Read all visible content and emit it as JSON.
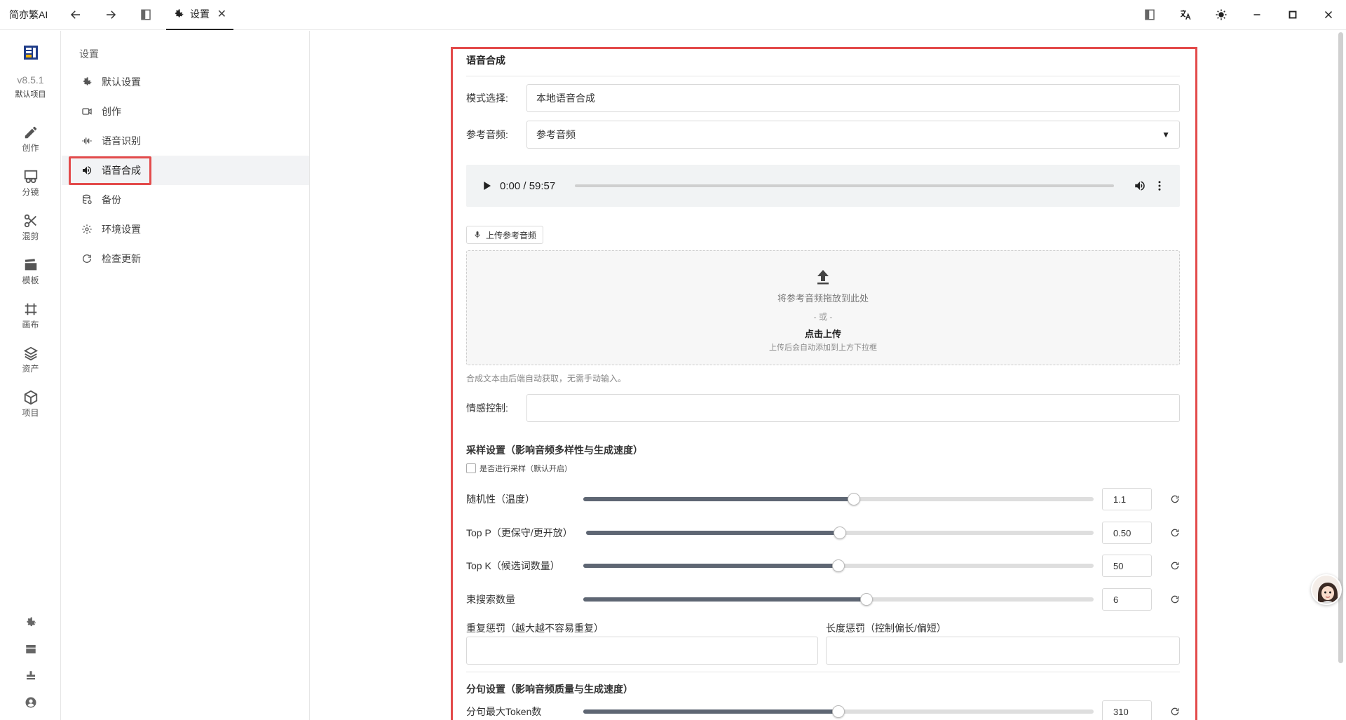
{
  "app": {
    "name": "简亦繁AI"
  },
  "tab": {
    "label": "设置",
    "close": "✕"
  },
  "rail": {
    "version": "v8.5.1",
    "project": "默认项目",
    "items": [
      {
        "label": "创作",
        "icon": "pencil-icon"
      },
      {
        "label": "分镜",
        "icon": "storyboard-icon"
      },
      {
        "label": "混剪",
        "icon": "scissors-icon"
      },
      {
        "label": "模板",
        "icon": "clapperboard-icon"
      },
      {
        "label": "画布",
        "icon": "canvas-icon"
      },
      {
        "label": "资产",
        "icon": "layers-icon"
      },
      {
        "label": "项目",
        "icon": "cube-icon"
      }
    ]
  },
  "settings_nav": {
    "title": "设置",
    "items": [
      {
        "label": "默认设置",
        "icon": "gear-icon"
      },
      {
        "label": "创作",
        "icon": "video-icon"
      },
      {
        "label": "语音识别",
        "icon": "waveform-icon"
      },
      {
        "label": "语音合成",
        "icon": "speaker-icon"
      },
      {
        "label": "备份",
        "icon": "database-icon"
      },
      {
        "label": "环境设置",
        "icon": "cog-icon"
      },
      {
        "label": "检查更新",
        "icon": "refresh-icon"
      }
    ],
    "active_index": 3
  },
  "panel": {
    "title": "语音合成",
    "mode_label": "模式选择:",
    "mode_value": "本地语音合成",
    "ref_audio_label": "参考音频:",
    "ref_audio_value": "参考音频",
    "audio_time": "0:00 / 59:57",
    "upload_button": "上传参考音频",
    "dropzone": {
      "text": "将参考音频拖放到此处",
      "or": "- 或 -",
      "click": "点击上传",
      "hint": "上传后会自动添加到上方下拉框"
    },
    "note": "合成文本由后端自动获取，无需手动输入。",
    "emotion_label": "情感控制:",
    "sampling_title": "采样设置（影响音频多样性与生成速度）",
    "sampling_checkbox": "是否进行采样（默认开启）",
    "sliders": [
      {
        "label": "随机性（温度）",
        "value": "1.1",
        "fraction": 0.53
      },
      {
        "label": "Top P（更保守/更开放）",
        "value": "0.50",
        "fraction": 0.5
      },
      {
        "label": "Top K（候选词数量）",
        "value": "50",
        "fraction": 0.5
      },
      {
        "label": "束搜索数量",
        "value": "6",
        "fraction": 0.555
      }
    ],
    "repeat_penalty_label": "重复惩罚（越大越不容易重复）",
    "length_penalty_label": "长度惩罚（控制偏长/偏短）",
    "split_title": "分句设置（影响音频质量与生成速度）",
    "split_slider": {
      "label": "分句最大Token数",
      "value": "310",
      "fraction": 0.5
    }
  }
}
